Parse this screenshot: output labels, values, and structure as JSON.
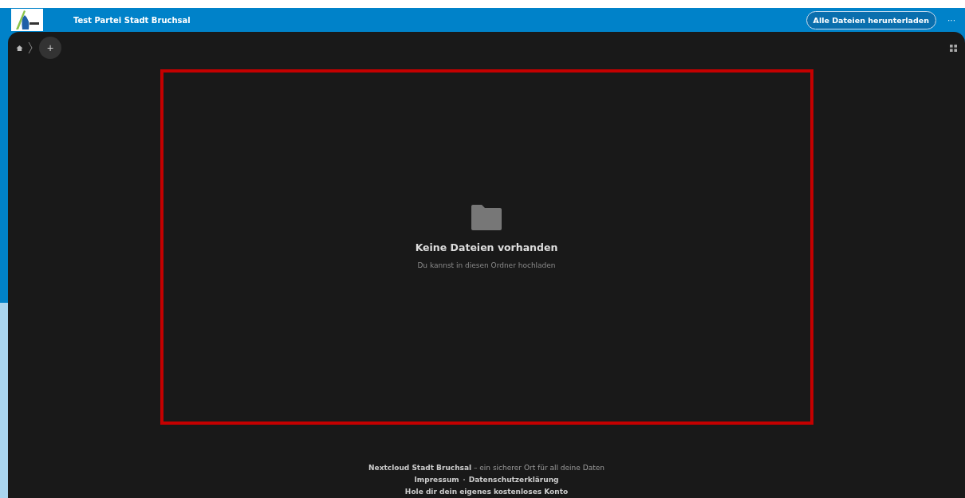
{
  "header": {
    "title": "Test Partei Stadt Bruchsal",
    "download_button": "Alle Dateien herunterladen",
    "more_button": "···"
  },
  "breadcrumb": {
    "add_button": "+"
  },
  "empty_state": {
    "title": "Keine Dateien vorhanden",
    "subtitle": "Du kannst in diesen Ordner hochladen"
  },
  "footer": {
    "lines": [
      {
        "bold": "Nextcloud Stadt Bruchsal",
        "rest": "– ein sicherer Ort für all deine Daten"
      }
    ],
    "links": [
      "Impressum",
      "Datenschutzerklärung"
    ],
    "signup": "Hole dir dein eigenes kostenloses Konto"
  }
}
